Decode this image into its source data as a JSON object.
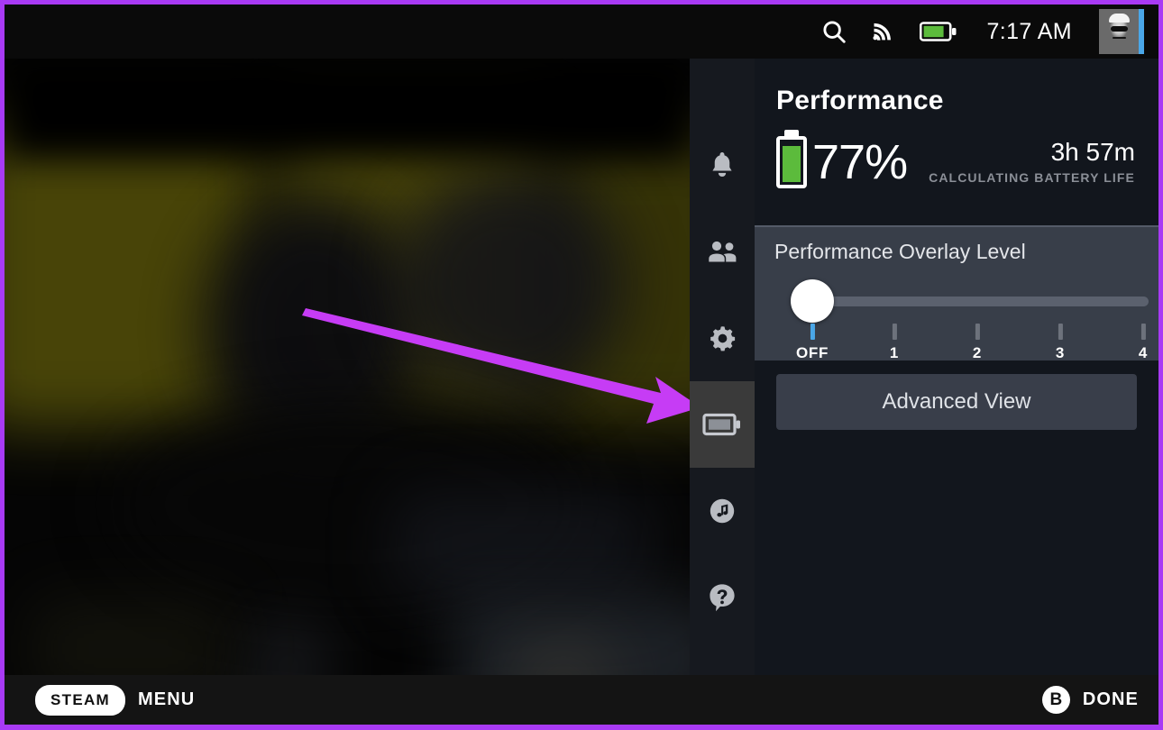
{
  "theme": {
    "border_purple": "#a83af5",
    "panel_bg": "#12161d",
    "section_bg": "#383e49",
    "accent_blue": "#4aa7e8",
    "battery_green": "#5cbb3c",
    "rail_bg": "#16191f",
    "rail_active_bg": "#3a3a3a"
  },
  "topbar": {
    "search_icon": "search-icon",
    "wifi_icon": "wifi-icon",
    "battery_icon": "battery-icon",
    "clock": "7:17 AM",
    "avatar": "user-avatar"
  },
  "rail": {
    "items": [
      {
        "name": "notifications",
        "icon": "bell-icon",
        "active": false
      },
      {
        "name": "friends",
        "icon": "people-icon",
        "active": false
      },
      {
        "name": "settings",
        "icon": "gear-icon",
        "active": false
      },
      {
        "name": "performance",
        "icon": "battery-icon",
        "active": true
      },
      {
        "name": "music",
        "icon": "music-note-icon",
        "active": false
      },
      {
        "name": "help",
        "icon": "question-mark-icon",
        "active": false
      }
    ]
  },
  "panel": {
    "title": "Performance",
    "battery": {
      "percent": "77%",
      "time_remaining": "3h 57m",
      "status": "CALCULATING BATTERY LIFE",
      "fill_level": 77
    },
    "overlay": {
      "label": "Performance Overlay Level",
      "selected_index": 0,
      "ticks": [
        {
          "label": "OFF",
          "value": 0
        },
        {
          "label": "1",
          "value": 1
        },
        {
          "label": "2",
          "value": 2
        },
        {
          "label": "3",
          "value": 3
        },
        {
          "label": "4",
          "value": 4
        }
      ]
    },
    "advanced_view_label": "Advanced View"
  },
  "bottombar": {
    "steam_label": "STEAM",
    "menu_label": "MENU",
    "b_button": "B",
    "done_label": "DONE"
  },
  "annotation": {
    "arrow_color": "#c63cf5",
    "arrow_target": "performance-rail-item"
  }
}
